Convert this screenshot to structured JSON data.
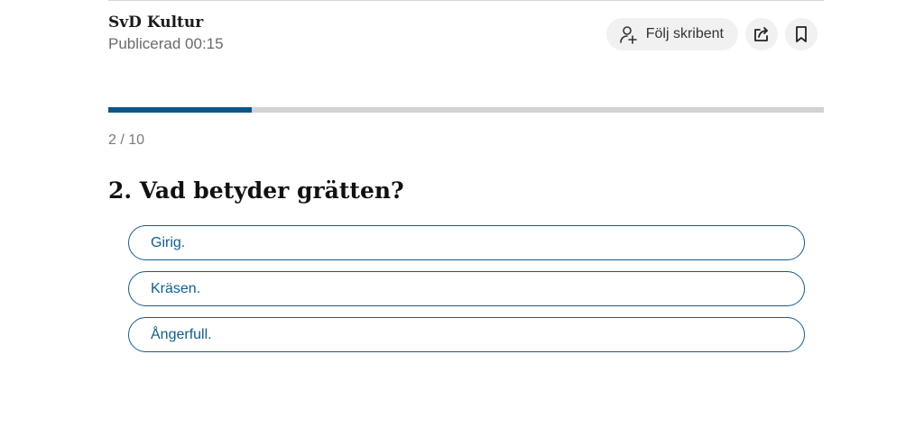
{
  "header": {
    "author": "SvD Kultur",
    "published": "Publicerad 00:15",
    "follow_label": "Följ skribent",
    "icons": {
      "follow": "person-plus-icon",
      "share": "share-icon",
      "bookmark": "bookmark-icon"
    }
  },
  "quiz": {
    "progress": {
      "current": 2,
      "total": 10,
      "fraction": 0.2,
      "label": "2 / 10"
    },
    "question": "2. Vad betyder grätten?",
    "options": [
      "Girig.",
      "Kräsen.",
      "Ångerfull."
    ]
  },
  "colors": {
    "accent": "#08568a",
    "option_border": "#0f5d8f",
    "track": "#d2d2d2"
  }
}
